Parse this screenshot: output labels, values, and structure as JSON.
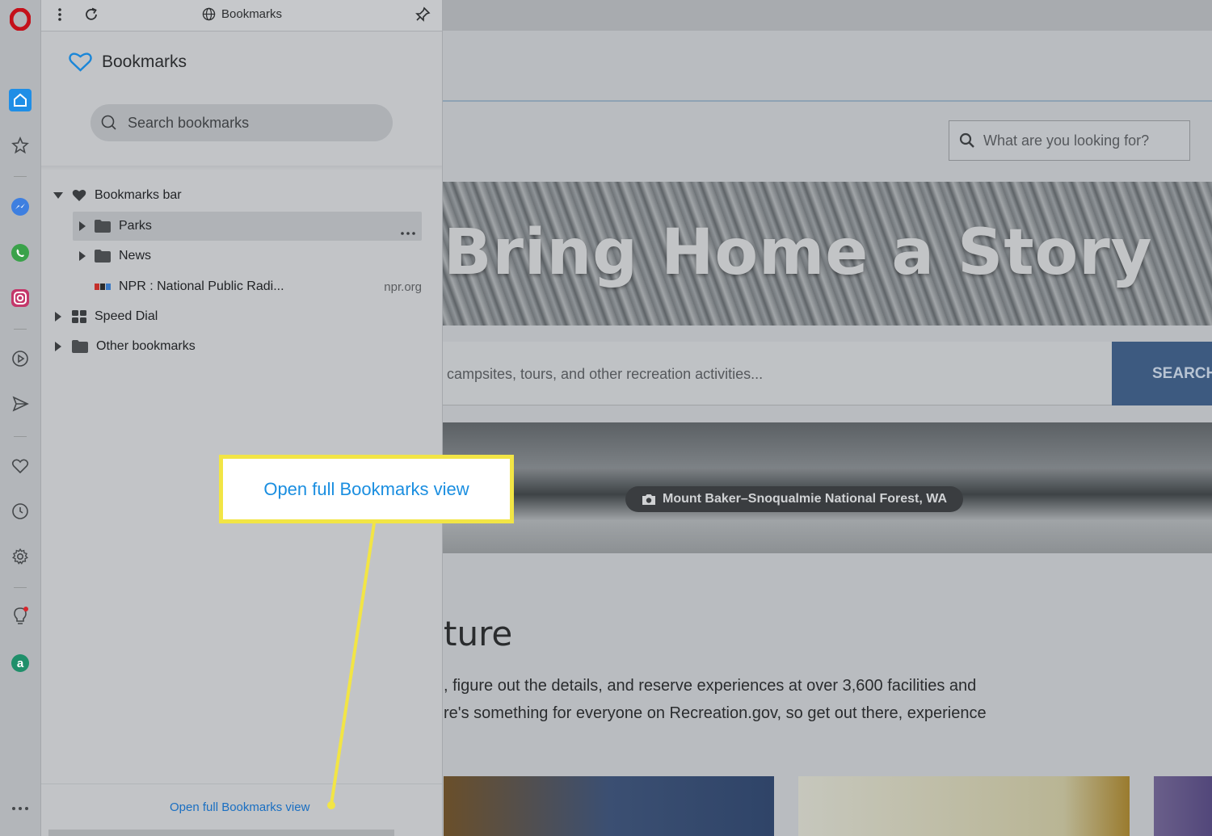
{
  "browser": {
    "rail_icons": [
      "opera-logo-icon",
      "home-icon",
      "star-icon",
      "messenger-icon",
      "whatsapp-icon",
      "instagram-icon",
      "player-icon",
      "send-icon",
      "heart-icon",
      "history-icon",
      "settings-icon",
      "lightbulb-icon",
      "aria-icon",
      "more-icon"
    ],
    "accent": "#1a8ee0"
  },
  "panel": {
    "header_title": "Bookmarks",
    "heading": "Bookmarks",
    "search_placeholder": "Search bookmarks",
    "tree": [
      {
        "label": "Bookmarks bar",
        "expanded": true
      },
      {
        "label": "Parks",
        "selected": true
      },
      {
        "label": "News"
      },
      {
        "label": "NPR : National Public Radi...",
        "url": "npr.org"
      },
      {
        "label": "Speed Dial"
      },
      {
        "label": "Other bookmarks"
      }
    ],
    "footer_link": "Open full Bookmarks view"
  },
  "callout": {
    "text": "Open full Bookmarks view",
    "border_color": "#f2e545"
  },
  "webpage": {
    "search_placeholder": "What are you looking for?",
    "hero_title": "Bring Home a Story",
    "rec_search_placeholder": "campsites, tours, and other recreation activities...",
    "rec_search_button": "SEARCH",
    "photo_caption": "Mount Baker–Snoqualmie National Forest, WA",
    "section_heading": "ture",
    "paragraph_line1": ", figure out the details, and reserve experiences at over 3,600 facilities and",
    "paragraph_line2": "re's something for everyone on Recreation.gov, so get out there, experience"
  }
}
